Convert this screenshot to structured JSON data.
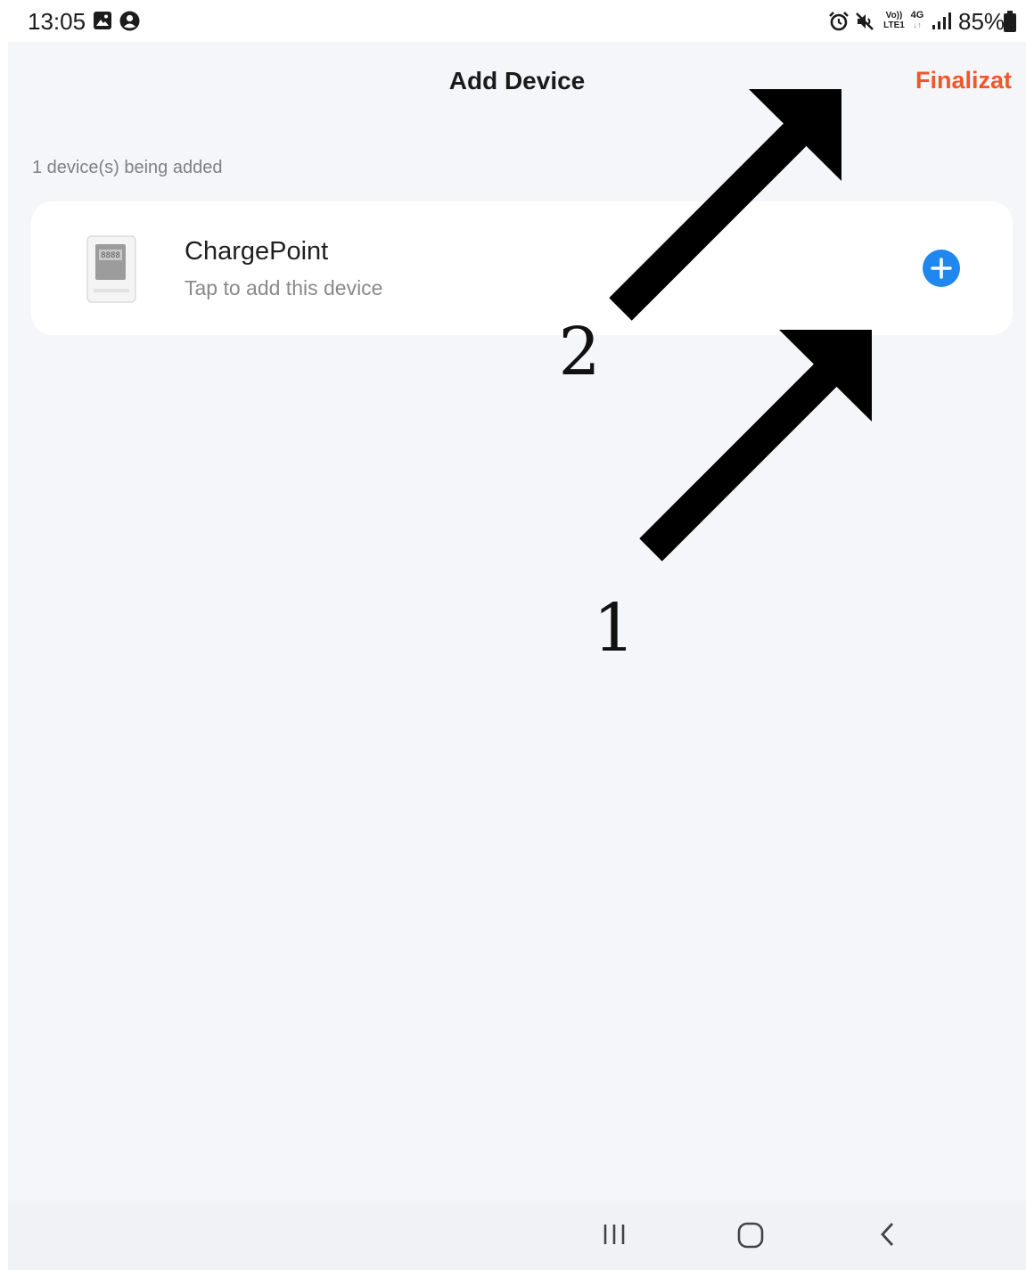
{
  "status_bar": {
    "time": "13:05",
    "battery_percent": "85%",
    "icons": [
      "gallery-icon",
      "account-icon",
      "alarm-icon",
      "mute-icon",
      "volte-icon",
      "4g-icon",
      "signal-icon",
      "battery-icon"
    ],
    "volte_top": "Vo))",
    "volte_bottom": "LTE1",
    "network_type": "4G"
  },
  "header": {
    "title": "Add Device",
    "done_label": "Finalizat",
    "done_color": "#f0572a"
  },
  "adding": {
    "count_text": "1 device(s) being added"
  },
  "device": {
    "name": "ChargePoint",
    "hint": "Tap to add this device",
    "display_text": "8888",
    "icon": "charger-device-icon",
    "add_color": "#1f87ee"
  },
  "annotations": {
    "arrow_1_label": "1",
    "arrow_2_label": "2"
  },
  "nav_bar": {
    "buttons": [
      "recents-icon",
      "home-icon",
      "back-icon"
    ]
  }
}
